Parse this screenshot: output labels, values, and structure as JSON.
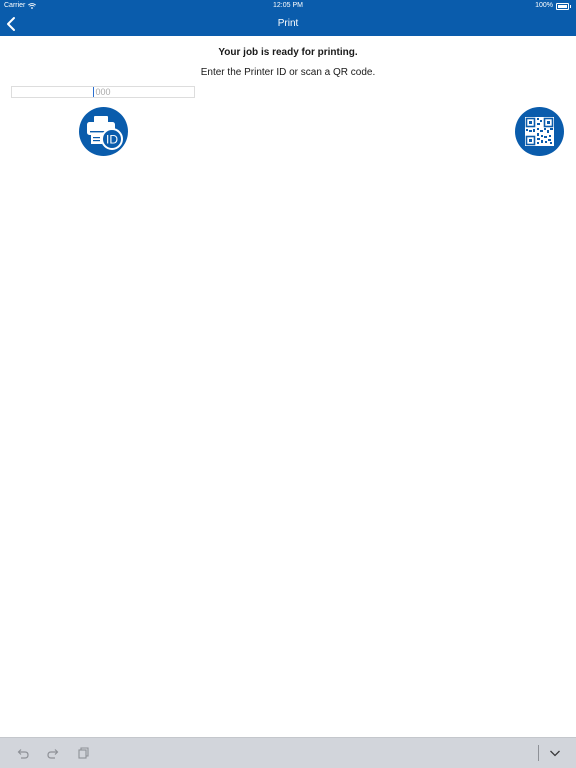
{
  "status_bar": {
    "carrier": "Carrier",
    "time": "12:05 PM",
    "battery": "100%",
    "battery_level": 1.0
  },
  "nav": {
    "title": "Print",
    "back_icon": "chevron-left-icon"
  },
  "content": {
    "headline": "Your job is ready for printing.",
    "instruction": "Enter the Printer ID or scan a QR code.",
    "printer_id_input": {
      "value": "",
      "placeholder": "000"
    },
    "printer_id_button_icon": "printer-id-icon",
    "qr_button_icon": "qr-code-icon"
  },
  "keyboard_toolbar": {
    "undo_icon": "undo-icon",
    "redo_icon": "redo-icon",
    "paste_icon": "paste-icon",
    "dismiss_icon": "chevron-down-icon"
  },
  "colors": {
    "brand": "#0a5cac",
    "toolbar": "#d2d5db",
    "toolbar_icon": "#8e9197"
  }
}
